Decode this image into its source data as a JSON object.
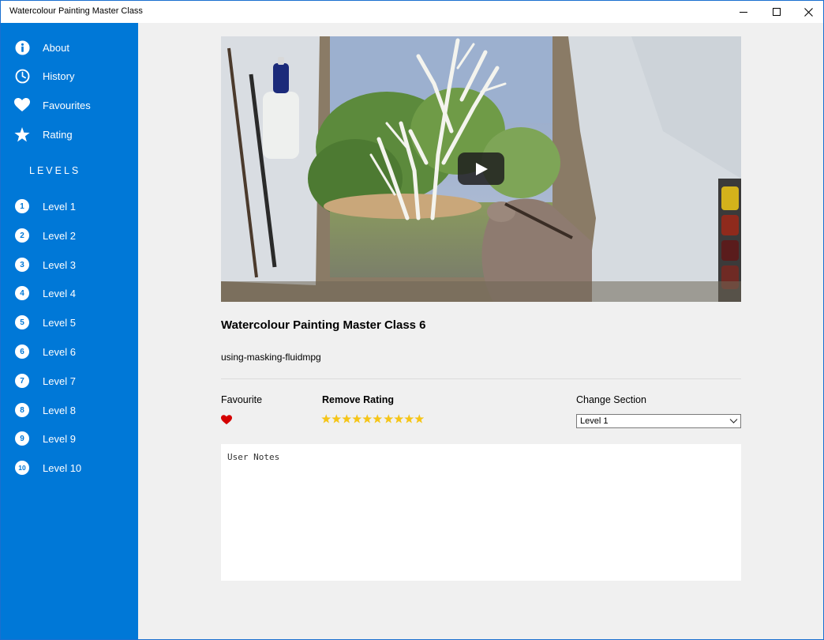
{
  "window": {
    "title": "Watercolour Painting Master Class"
  },
  "sidebar": {
    "items": [
      {
        "label": "About",
        "icon": "info-icon"
      },
      {
        "label": "History",
        "icon": "clock-icon"
      },
      {
        "label": "Favourites",
        "icon": "heart-icon"
      },
      {
        "label": "Rating",
        "icon": "star-icon"
      }
    ],
    "levels_heading": "LEVELS",
    "levels": [
      {
        "num": "1",
        "label": "Level 1"
      },
      {
        "num": "2",
        "label": "Level 2"
      },
      {
        "num": "3",
        "label": "Level 3"
      },
      {
        "num": "4",
        "label": "Level 4"
      },
      {
        "num": "5",
        "label": "Level 5"
      },
      {
        "num": "6",
        "label": "Level 6"
      },
      {
        "num": "7",
        "label": "Level 7"
      },
      {
        "num": "8",
        "label": "Level 8"
      },
      {
        "num": "9",
        "label": "Level 9"
      },
      {
        "num": "10",
        "label": "Level 10"
      }
    ]
  },
  "video": {
    "title": "Watercolour Painting Master Class 6",
    "filename": "using-masking-fluidmpg"
  },
  "controls": {
    "favourite_label": "Favourite",
    "favourite_on": true,
    "rating_label": "Remove Rating",
    "rating_stars": 10,
    "rating_max": 10,
    "section_label": "Change Section",
    "section_value": "Level 1"
  },
  "notes": {
    "placeholder": "User Notes"
  },
  "colors": {
    "sidebar": "#0078d7",
    "heart": "#d40000",
    "star": "#f5c518"
  }
}
